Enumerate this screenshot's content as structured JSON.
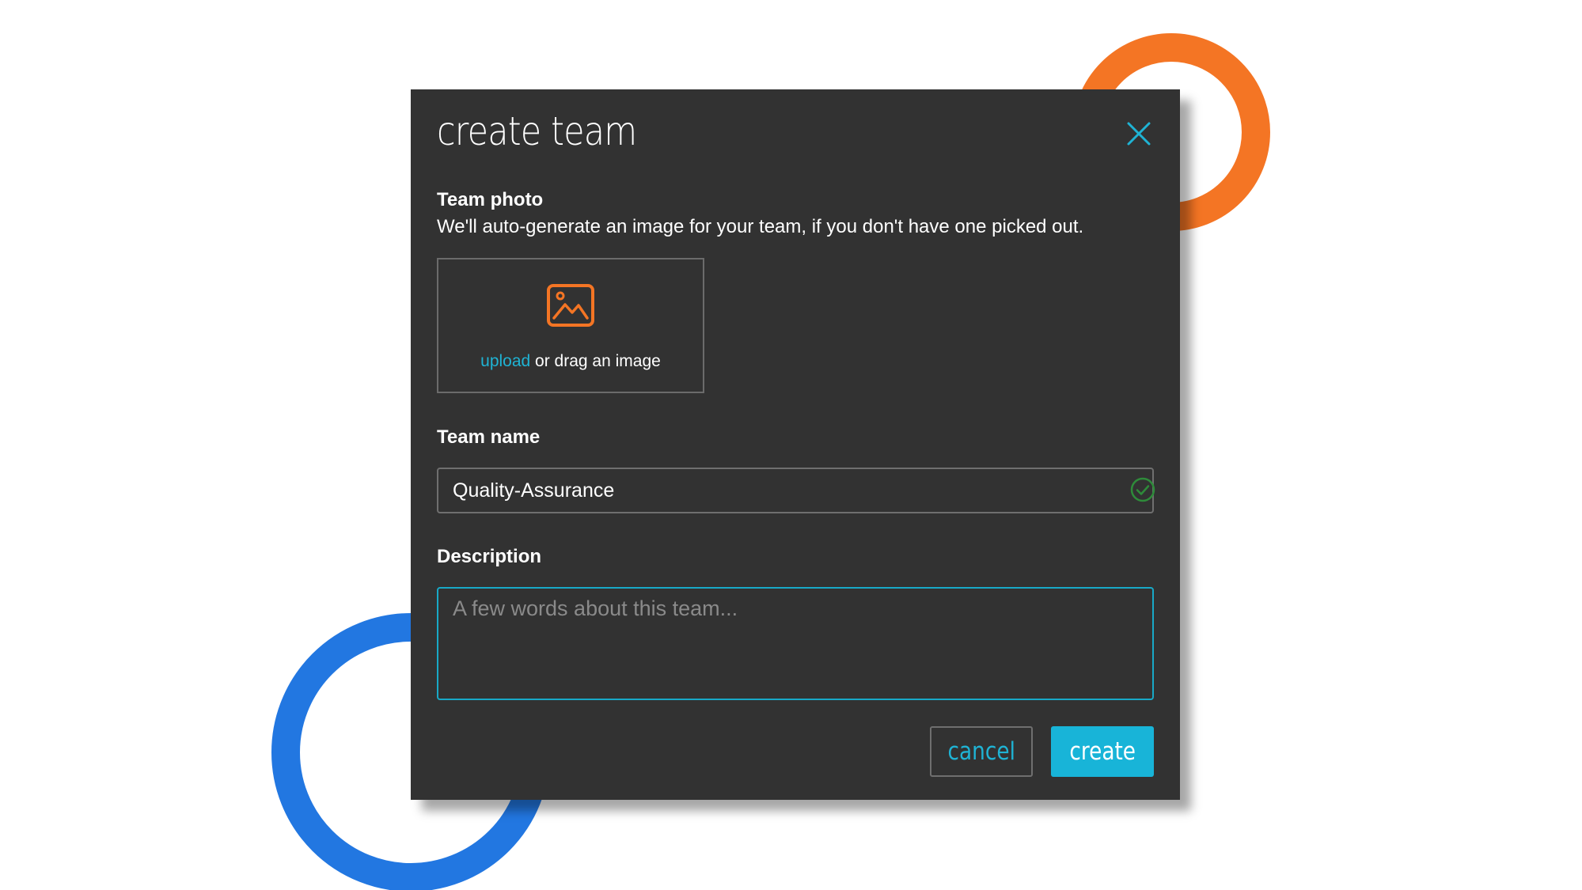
{
  "modal": {
    "title": "create team",
    "close_icon": "close-icon"
  },
  "photo": {
    "label": "Team photo",
    "hint": "We'll auto-generate an image for your team, if you don't have one picked out.",
    "dropzone": {
      "icon": "image-icon",
      "upload_link": "upload",
      "drag_text": " or drag an image"
    }
  },
  "team_name": {
    "label": "Team name",
    "value": "Quality-Assurance",
    "status_icon": "check-circle-icon"
  },
  "description": {
    "label": "Description",
    "placeholder": "A few words about this team...",
    "value": ""
  },
  "actions": {
    "cancel_label": "cancel",
    "create_label": "create"
  },
  "colors": {
    "modal_bg": "#323232",
    "accent": "#18b4d8",
    "image_icon": "#f47524",
    "valid_check": "#2e8b3a",
    "decor_orange": "#f47524",
    "decor_blue": "#2277e1"
  }
}
